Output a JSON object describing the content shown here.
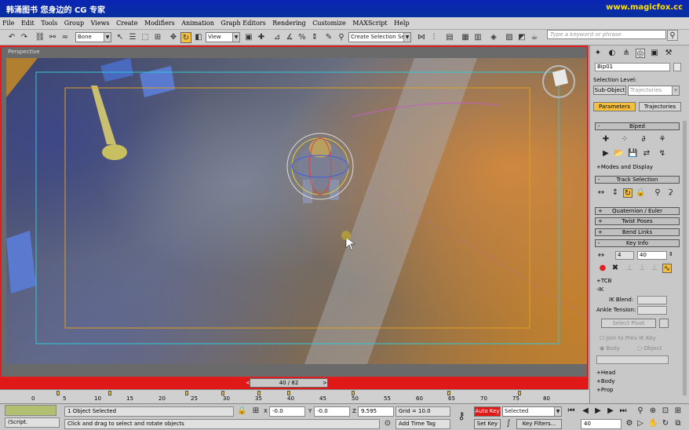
{
  "title_bar": {
    "left": "韩涌图书 您身边的 CG 专家",
    "right": "www.magicfox.cc"
  },
  "menu": [
    "File",
    "Edit",
    "Tools",
    "Group",
    "Views",
    "Create",
    "Modifiers",
    "Animation",
    "Graph Editors",
    "Rendering",
    "Customize",
    "MAXScript",
    "Help"
  ],
  "toolbar": {
    "filter": "Bone",
    "refcoord": "View",
    "named_selection": "Create Selection Set",
    "search_placeholder": "Type a keyword or phrase"
  },
  "viewport": {
    "label": "Perspective"
  },
  "timeline": {
    "frame_display": "40 / 82",
    "ticks": [
      "0",
      "5",
      "10",
      "15",
      "20",
      "25",
      "30",
      "35",
      "40",
      "45",
      "50",
      "55",
      "60",
      "65",
      "70",
      "75",
      "80"
    ]
  },
  "command_panel": {
    "object_name": "Bip01",
    "selection_level": "Selection Level:",
    "sub_object": "Sub-Object",
    "trajectories_combo": "Trajectories",
    "tab_parameters": "Parameters",
    "tab_trajectories": "Trajectories",
    "biped": "Biped",
    "modes_display": "Modes and Display",
    "track_selection": "Track Selection",
    "quaternion": "Quaternion / Euler",
    "twist_poses": "Twist Poses",
    "bend_links": "Bend Links",
    "key_info": "Key Info",
    "key_num": "4",
    "key_frame": "40",
    "tcb": "TCB",
    "ik": "IK",
    "ik_blend": "IK Blend:",
    "ankle_tension": "Ankle Tension:",
    "select_pivot": "Select Pivot",
    "join_prev": "Join to Prev IK Key",
    "body": "Body",
    "object": "Object",
    "head": "Head",
    "body2": "Body",
    "prop": "Prop"
  },
  "status": {
    "selected": "1 Object Selected",
    "prompt": "Click and drag to select and rotate objects",
    "script": "(Script.",
    "x_label": "X",
    "x": "-0.0",
    "y_label": "Y",
    "y": "-0.0",
    "z_label": "Z",
    "z": "9.595",
    "grid": "Grid = 10.0",
    "add_time_tag": "Add Time Tag",
    "auto_key": "Auto Key",
    "set_key": "Set Key",
    "selected_combo": "Selected",
    "key_filters": "Key Filters...",
    "current_frame": "40"
  },
  "colors": {
    "accent_red": "#e01818",
    "orange_tab": "#f5c040"
  }
}
